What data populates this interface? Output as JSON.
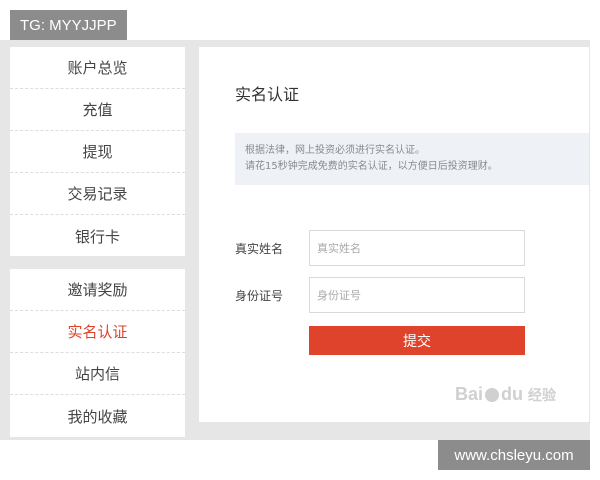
{
  "watermark": {
    "top": "TG: MYYJJPP",
    "bottom": "www.chsleyu.com",
    "baidu_text": "Bai",
    "baidu_text2": "du",
    "baidu_cn": "经验"
  },
  "sidebar": {
    "group1": [
      {
        "label": "账户总览"
      },
      {
        "label": "充值"
      },
      {
        "label": "提现"
      },
      {
        "label": "交易记录"
      },
      {
        "label": "银行卡"
      }
    ],
    "group2": [
      {
        "label": "邀请奖励"
      },
      {
        "label": "实名认证",
        "active": true
      },
      {
        "label": "站内信"
      },
      {
        "label": "我的收藏"
      }
    ]
  },
  "main": {
    "title": "实名认证",
    "notice_line1": "根据法律，网上投资必须进行实名认证。",
    "notice_line2": "请花15秒钟完成免费的实名认证，以方便日后投资理财。",
    "name_label": "真实姓名",
    "name_placeholder": "真实姓名",
    "id_label": "身份证号",
    "id_placeholder": "身份证号",
    "submit_label": "提交"
  },
  "colors": {
    "accent": "#e0432b",
    "notice_bg": "#eef2f6",
    "frame": "#e6e6e6"
  }
}
